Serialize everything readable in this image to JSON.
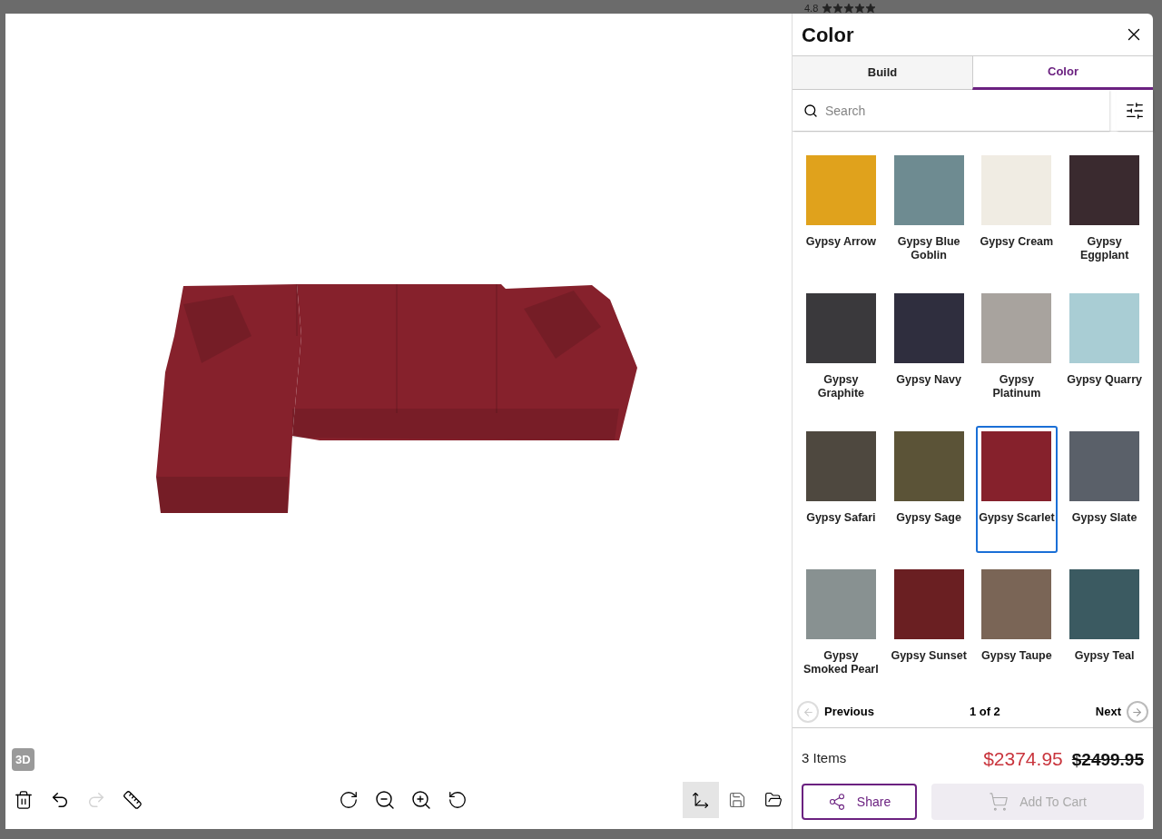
{
  "background": {
    "rating": "4.8",
    "stars": 5
  },
  "viewer": {
    "badge": "3D"
  },
  "panel": {
    "title": "Color",
    "tabs": [
      {
        "label": "Build",
        "selected": false
      },
      {
        "label": "Color",
        "selected": true
      }
    ],
    "search": {
      "placeholder": "Search"
    },
    "swatches": [
      {
        "name": "Gypsy Arrow",
        "color": "#e0a21c",
        "selected": false
      },
      {
        "name": "Gypsy Blue Goblin",
        "color": "#6e8b91",
        "selected": false
      },
      {
        "name": "Gypsy Cream",
        "color": "#f0ece3",
        "selected": false
      },
      {
        "name": "Gypsy Eggplant",
        "color": "#3a2a2f",
        "selected": false
      },
      {
        "name": "Gypsy Graphite",
        "color": "#3a393c",
        "selected": false
      },
      {
        "name": "Gypsy Navy",
        "color": "#2f2e3e",
        "selected": false
      },
      {
        "name": "Gypsy Platinum",
        "color": "#a8a39e",
        "selected": false
      },
      {
        "name": "Gypsy Quarry",
        "color": "#a9cdd4",
        "selected": false
      },
      {
        "name": "Gypsy Safari",
        "color": "#4e483f",
        "selected": false
      },
      {
        "name": "Gypsy Sage",
        "color": "#5b5337",
        "selected": false
      },
      {
        "name": "Gypsy Scarlet",
        "color": "#86212c",
        "selected": true
      },
      {
        "name": "Gypsy Slate",
        "color": "#5a6069",
        "selected": false
      },
      {
        "name": "Gypsy Smoked Pearl",
        "color": "#889191",
        "selected": false
      },
      {
        "name": "Gypsy Sunset",
        "color": "#6a1f22",
        "selected": false
      },
      {
        "name": "Gypsy Taupe",
        "color": "#7a6556",
        "selected": false
      },
      {
        "name": "Gypsy Teal",
        "color": "#3b5a61",
        "selected": false
      }
    ],
    "pagination": {
      "previous": "Previous",
      "page": "1 of 2",
      "next": "Next"
    },
    "summary": {
      "items": "3 Items",
      "price": "$2374.95",
      "original_price": "$2499.95"
    },
    "buttons": {
      "share": "Share",
      "add_to_cart": "Add To Cart",
      "add_to_cart_disabled": true
    }
  }
}
